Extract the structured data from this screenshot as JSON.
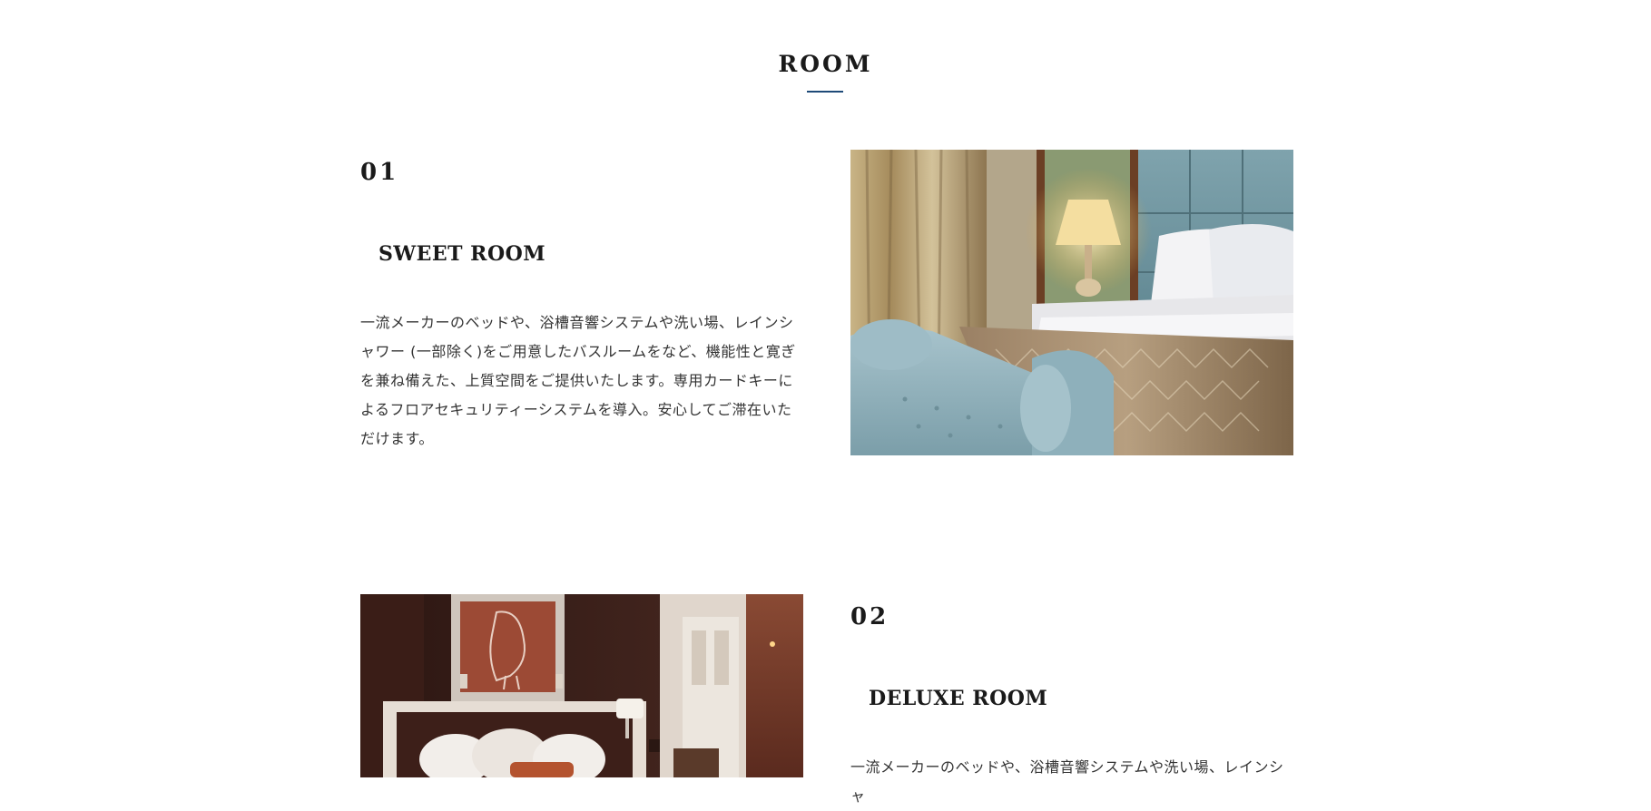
{
  "section": {
    "title": "ROOM"
  },
  "rooms": [
    {
      "number": "01",
      "name": "SWEET ROOM",
      "description": "一流メーカーのベッドや、浴槽音響システムや洗い場、レインシャワー (一部除く)をご用意したバスルームをなど、機能性と寛ぎを兼ね備えた、上質空間をご提供いたします。専用カードキーによるフロアセキュリティーシステムを導入。安心してご滞在いただけます。",
      "image": "hotel-bed-with-blue-bench-photo"
    },
    {
      "number": "02",
      "name": "DELUXE ROOM",
      "description": "一流メーカーのベッドや、浴槽音響システムや洗い場、レインシャ",
      "image": "hotel-room-dark-headboard-photo"
    }
  ],
  "colors": {
    "accent": "#1e4a78",
    "text": "#1a1a1a"
  }
}
